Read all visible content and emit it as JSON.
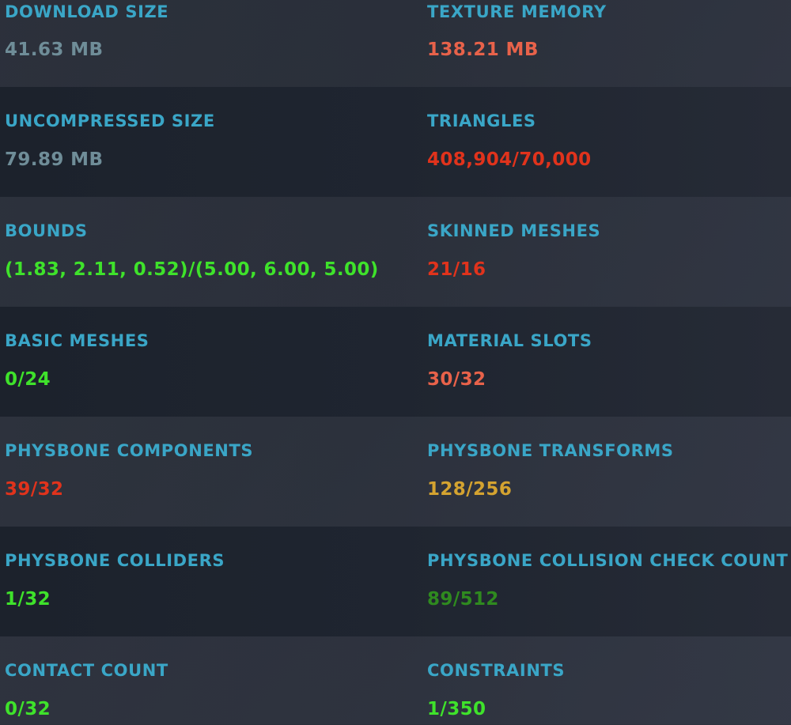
{
  "colors": {
    "label": "#3aa6c7",
    "neutral": "#6f8d98",
    "good": "#3fe22b",
    "good_dim": "#2f8a1f",
    "warning": "#d4a330",
    "poor": "#e8624a",
    "very_poor": "#e0331c"
  },
  "rows": [
    {
      "left": {
        "label": "DOWNLOAD SIZE",
        "value": "41.63 MB",
        "color": "#6f8d98"
      },
      "right": {
        "label": "TEXTURE MEMORY",
        "value": "138.21 MB",
        "color": "#e8624a"
      }
    },
    {
      "left": {
        "label": "UNCOMPRESSED SIZE",
        "value": "79.89 MB",
        "color": "#6f8d98"
      },
      "right": {
        "label": "TRIANGLES",
        "value": "408,904/70,000",
        "color": "#e0331c"
      }
    },
    {
      "left": {
        "label": "BOUNDS",
        "value": "(1.83, 2.11, 0.52)/(5.00, 6.00, 5.00)",
        "color": "#3fe22b"
      },
      "right": {
        "label": "SKINNED MESHES",
        "value": "21/16",
        "color": "#e0331c"
      }
    },
    {
      "left": {
        "label": "BASIC MESHES",
        "value": "0/24",
        "color": "#3fe22b"
      },
      "right": {
        "label": "MATERIAL SLOTS",
        "value": "30/32",
        "color": "#e8624a"
      }
    },
    {
      "left": {
        "label": "PHYSBONE COMPONENTS",
        "value": "39/32",
        "color": "#e0331c"
      },
      "right": {
        "label": "PHYSBONE TRANSFORMS",
        "value": "128/256",
        "color": "#d4a330"
      }
    },
    {
      "left": {
        "label": "PHYSBONE COLLIDERS",
        "value": "1/32",
        "color": "#3fe22b"
      },
      "right": {
        "label": "PHYSBONE COLLISION CHECK COUNT",
        "value": "89/512",
        "color": "#2f8a1f"
      }
    },
    {
      "left": {
        "label": "CONTACT COUNT",
        "value": "0/32",
        "color": "#3fe22b"
      },
      "right": {
        "label": "CONSTRAINTS",
        "value": "1/350",
        "color": "#3fe22b"
      }
    }
  ]
}
